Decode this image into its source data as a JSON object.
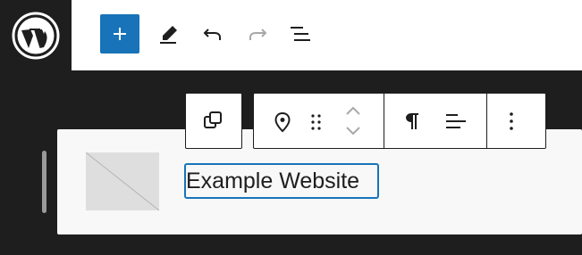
{
  "top_toolbar": {
    "logo": "wordpress-logo",
    "buttons": [
      {
        "name": "add-block",
        "icon": "plus-icon"
      },
      {
        "name": "tools",
        "icon": "pencil-icon"
      },
      {
        "name": "undo",
        "icon": "undo-icon"
      },
      {
        "name": "redo",
        "icon": "redo-icon",
        "disabled": true
      },
      {
        "name": "document-overview",
        "icon": "list-view-icon"
      }
    ]
  },
  "block_toolbar": {
    "transform": {
      "icon": "transform-icon"
    },
    "controls": [
      {
        "name": "site-logo",
        "icon": "location-pin-icon"
      },
      {
        "name": "drag",
        "icon": "drag-handle-icon"
      },
      {
        "name": "move-up",
        "icon": "chevron-up-icon"
      },
      {
        "name": "move-down",
        "icon": "chevron-down-icon"
      },
      {
        "name": "transform-paragraph",
        "icon": "paragraph-icon"
      },
      {
        "name": "align",
        "icon": "align-left-icon"
      },
      {
        "name": "more-options",
        "icon": "more-vertical-icon"
      }
    ]
  },
  "block": {
    "site_title": "Example Website",
    "logo_placeholder": "image-placeholder"
  },
  "colors": {
    "accent": "#1873b8",
    "dark": "#1e1e1e",
    "canvas": "#f8f8f8",
    "placeholder": "#dedede"
  }
}
